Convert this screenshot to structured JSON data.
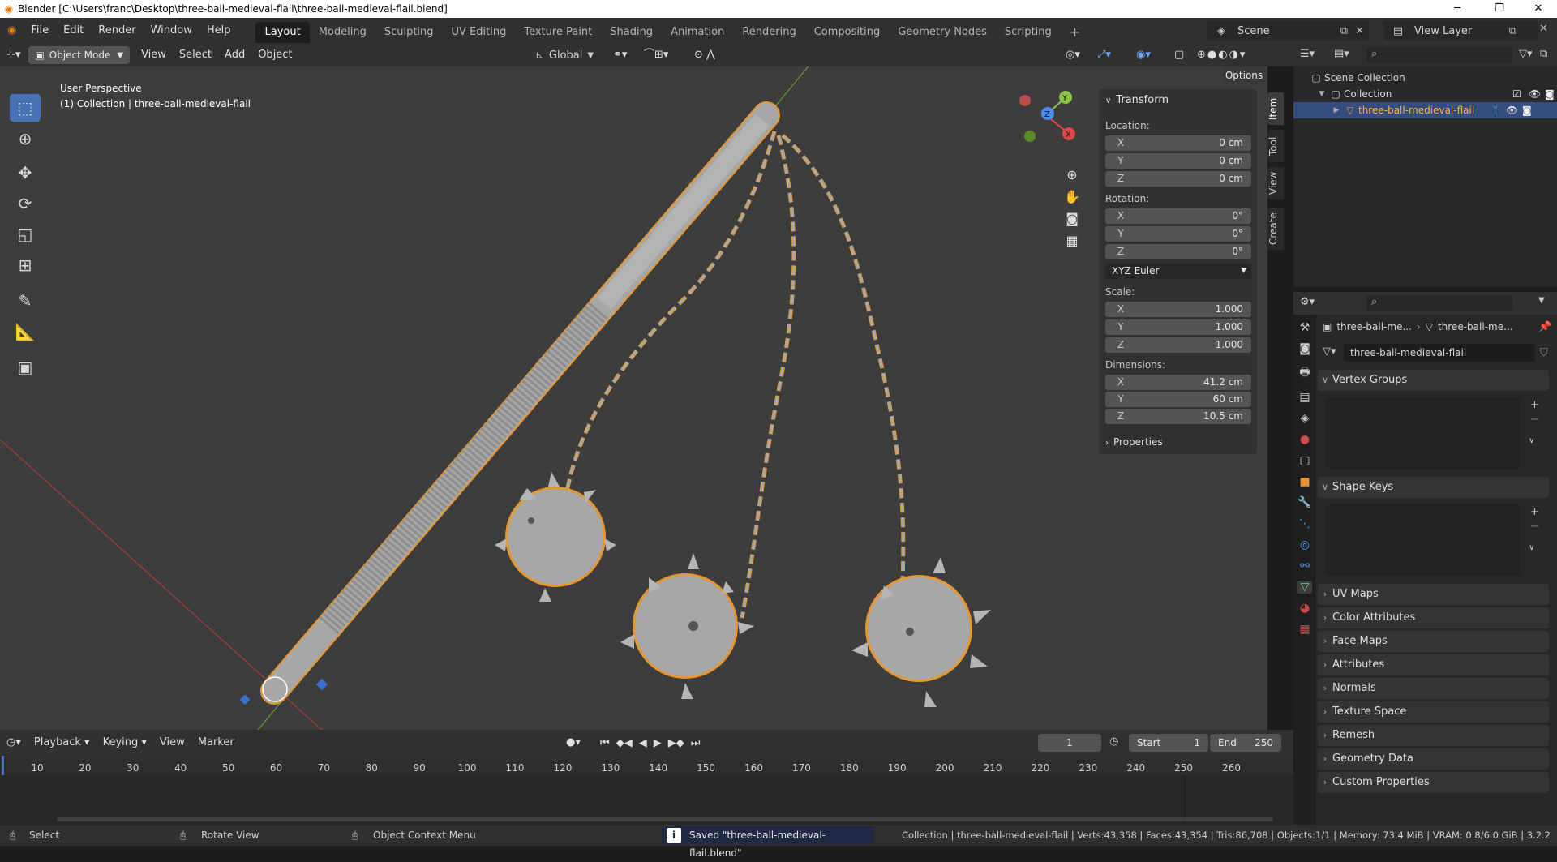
{
  "window": {
    "title": "Blender [C:\\Users\\franc\\Desktop\\three-ball-medieval-flail\\three-ball-medieval-flail.blend]"
  },
  "menus": [
    "File",
    "Edit",
    "Render",
    "Window",
    "Help"
  ],
  "workspaces": [
    "Layout",
    "Modeling",
    "Sculpting",
    "UV Editing",
    "Texture Paint",
    "Shading",
    "Animation",
    "Rendering",
    "Compositing",
    "Geometry Nodes",
    "Scripting"
  ],
  "active_workspace": "Layout",
  "scene": "Scene",
  "view_layer": "View Layer",
  "viewport_header": {
    "mode": "Object Mode",
    "menus": [
      "View",
      "Select",
      "Add",
      "Object"
    ],
    "orientation": "Global",
    "options": "Options"
  },
  "viewport": {
    "overlay_line1": "User Perspective",
    "overlay_line2": "(1) Collection | three-ball-medieval-flail",
    "gizmo_labels": {
      "y": "Y",
      "z": "Z",
      "x": "X"
    }
  },
  "npanel": {
    "tabs": [
      "Item",
      "Tool",
      "View",
      "Create"
    ],
    "section": "Transform",
    "location_label": "Location:",
    "location": [
      {
        "axis": "X",
        "value": "0 cm"
      },
      {
        "axis": "Y",
        "value": "0 cm"
      },
      {
        "axis": "Z",
        "value": "0 cm"
      }
    ],
    "rotation_label": "Rotation:",
    "rotation": [
      {
        "axis": "X",
        "value": "0°"
      },
      {
        "axis": "Y",
        "value": "0°"
      },
      {
        "axis": "Z",
        "value": "0°"
      }
    ],
    "rotation_mode": "XYZ Euler",
    "scale_label": "Scale:",
    "scale": [
      {
        "axis": "X",
        "value": "1.000"
      },
      {
        "axis": "Y",
        "value": "1.000"
      },
      {
        "axis": "Z",
        "value": "1.000"
      }
    ],
    "dimensions_label": "Dimensions:",
    "dimensions": [
      {
        "axis": "X",
        "value": "41.2 cm"
      },
      {
        "axis": "Y",
        "value": "60 cm"
      },
      {
        "axis": "Z",
        "value": "10.5 cm"
      }
    ],
    "properties": "Properties"
  },
  "outliner": {
    "scene_collection": "Scene Collection",
    "collection": "Collection",
    "object": "three-ball-medieval-flail"
  },
  "properties": {
    "breadcrumb_1": "three-ball-me...",
    "breadcrumb_2": "three-ball-me...",
    "mesh_name": "three-ball-medieval-flail",
    "sections": [
      "Vertex Groups",
      "Shape Keys",
      "UV Maps",
      "Color Attributes",
      "Face Maps",
      "Attributes",
      "Normals",
      "Texture Space",
      "Remesh",
      "Geometry Data",
      "Custom Properties"
    ]
  },
  "timeline": {
    "menus": [
      "Playback",
      "Keying",
      "View",
      "Marker"
    ],
    "current_frame": "1",
    "start_label": "Start",
    "start": "1",
    "end_label": "End",
    "end": "250",
    "ticks": [
      "10",
      "20",
      "30",
      "40",
      "50",
      "60",
      "70",
      "80",
      "90",
      "100",
      "110",
      "120",
      "130",
      "140",
      "150",
      "160",
      "170",
      "180",
      "190",
      "200",
      "210",
      "220",
      "230",
      "240",
      "250",
      "260"
    ]
  },
  "statusbar": {
    "select": "Select",
    "rotate": "Rotate View",
    "context": "Object Context Menu",
    "saved": "Saved \"three-ball-medieval-flail.blend\"",
    "stats": "Collection | three-ball-medieval-flail | Verts:43,358 | Faces:43,354 | Tris:86,708 | Objects:1/1 | Memory: 73.4 MiB | VRAM: 0.8/6.0 GiB | 3.2.2"
  },
  "colors": {
    "accent": "#4772b3",
    "selection_outline": "#e8962f",
    "mesh": "#a7a7a7"
  }
}
